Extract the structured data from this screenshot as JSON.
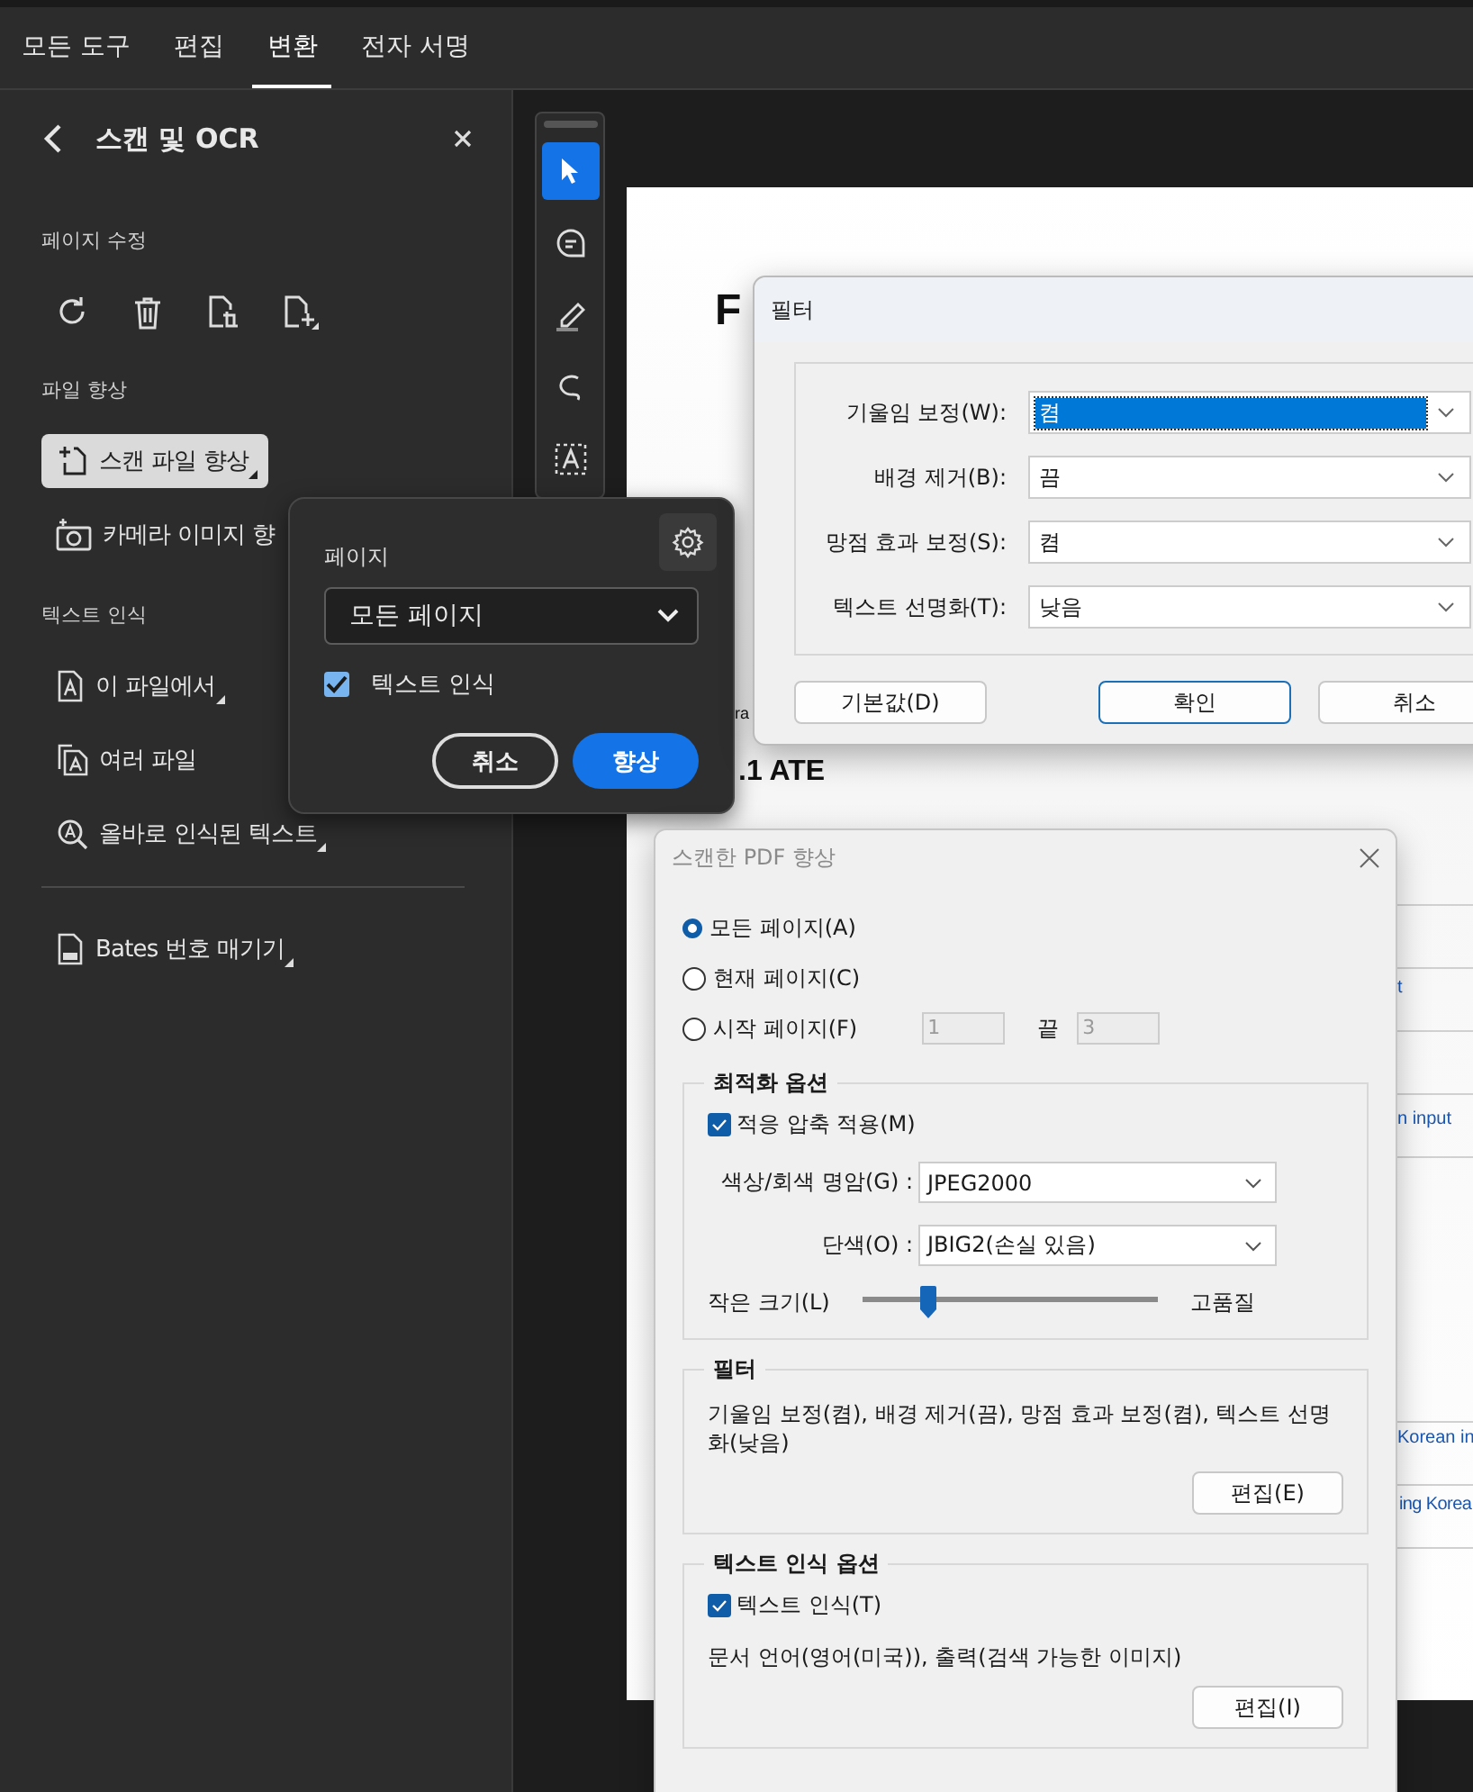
{
  "tabs": [
    {
      "label": "모든 도구",
      "selected": false
    },
    {
      "label": "편집",
      "selected": false
    },
    {
      "label": "변환",
      "selected": true
    },
    {
      "label": "전자 서명",
      "selected": false
    }
  ],
  "panel": {
    "title": "스캔 및 OCR",
    "sections": [
      {
        "heading": "페이지 수정",
        "kind": "icons"
      },
      {
        "heading": "파일 향상",
        "kind": "list",
        "items": [
          {
            "label": "스캔 파일 향상",
            "selected": true,
            "submenu": true
          },
          {
            "label": "카메라 이미지 향",
            "selected": false,
            "submenu": false
          }
        ]
      },
      {
        "heading": "텍스트 인식",
        "kind": "list",
        "items": [
          {
            "label": "이 파일에서",
            "selected": false,
            "submenu": true
          },
          {
            "label": "여러 파일",
            "selected": false,
            "submenu": false
          },
          {
            "label": "올바로 인식된 텍스트",
            "selected": false,
            "submenu": true
          }
        ]
      },
      {
        "kind": "list",
        "items": [
          {
            "label": "Bates 번호 매기기",
            "selected": false,
            "submenu": true
          }
        ]
      }
    ]
  },
  "toolbar": {
    "tools": [
      {
        "selected": true
      },
      {
        "selected": false
      },
      {
        "selected": false
      },
      {
        "selected": false
      },
      {
        "selected": false
      }
    ]
  },
  "document": {
    "texts": [
      "F",
      "ra",
      ".1 ATE",
      "t",
      "n input",
      "Korean in",
      "ing Korea"
    ]
  },
  "popover": {
    "label": "페이지",
    "select": "모든 페이지",
    "checkbox": {
      "label": "텍스트 인식",
      "checked": true
    },
    "buttons": [
      {
        "label": "취소",
        "kind": "secondary"
      },
      {
        "label": "향상",
        "kind": "primary"
      }
    ]
  },
  "filter_dialog": {
    "title": "필터",
    "rows": [
      {
        "label": "기울임 보정(W):",
        "value": "켬",
        "focused": true
      },
      {
        "label": "배경 제거(B):",
        "value": "끔",
        "focused": false
      },
      {
        "label": "망점 효과 보정(S):",
        "value": "켬",
        "focused": false
      },
      {
        "label": "텍스트 선명화(T):",
        "value": "낮음",
        "focused": false
      }
    ],
    "buttons": [
      {
        "label": "기본값(D)",
        "default": false
      },
      {
        "label": "확인",
        "default": true
      },
      {
        "label": "취소",
        "default": false
      }
    ]
  },
  "scan_dialog": {
    "title": "스캔한 PDF 향상",
    "pages": [
      {
        "label": "모든 페이지(A)",
        "selected": true
      },
      {
        "label": "현재 페이지(C)",
        "selected": false
      },
      {
        "label": "시작 페이지(F)",
        "selected": false
      }
    ],
    "range": {
      "from": "1",
      "to_label": "끝",
      "to": "3",
      "disabled": true
    },
    "optimization": {
      "title": "최적화 옵션",
      "adaptive": {
        "label": "적응 압축 적용(M)",
        "checked": true
      },
      "color": {
        "label": "색상/회색 명암(G) :",
        "value": "JPEG2000"
      },
      "mono": {
        "label": "단색(O) :",
        "value": "JBIG2(손실 있음)"
      },
      "slider": {
        "min_label": "작은 크기(L)",
        "max_label": "고품질",
        "level": 0.22
      }
    },
    "filter": {
      "title": "필터",
      "summary": "기울임 보정(켬), 배경 제거(끔), 망점 효과 보정(켬), 텍스트 선명화(낮음)",
      "button": "편집(E)"
    },
    "ocr": {
      "title": "텍스트 인식 옵션",
      "checkbox": {
        "label": "텍스트 인식(T)",
        "checked": true
      },
      "summary": "문서 언어(영어(미국)), 출력(검색 가능한 이미지)",
      "button": "편집(I)"
    }
  }
}
